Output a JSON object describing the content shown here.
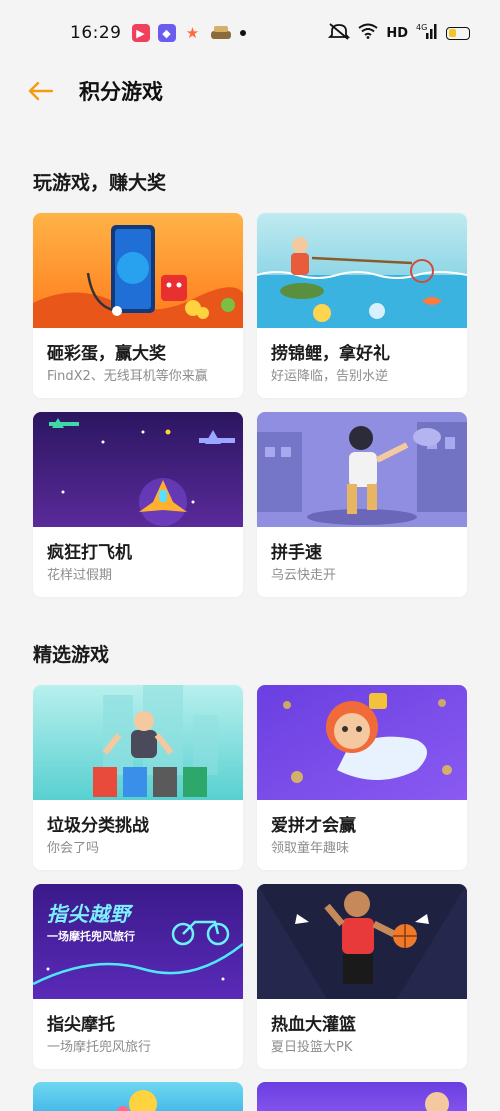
{
  "status_bar": {
    "time": "16:29",
    "network": "HD",
    "signal": "4G"
  },
  "header": {
    "title": "积分游戏",
    "back_icon": "arrow-left-icon",
    "accent": "#f39c12"
  },
  "sections": [
    {
      "title": "玩游戏，赚大奖",
      "cards": [
        {
          "name": "砸彩蛋，赢大奖",
          "desc": "FindX2、无线耳机等你来赢"
        },
        {
          "name": "捞锦鲤，拿好礼",
          "desc": "好运降临，告别水逆"
        },
        {
          "name": "疯狂打飞机",
          "desc": "花样过假期"
        },
        {
          "name": "拼手速",
          "desc": "乌云快走开"
        }
      ]
    },
    {
      "title": "精选游戏",
      "cards": [
        {
          "name": "垃圾分类挑战",
          "desc": "你会了吗"
        },
        {
          "name": "爱拼才会赢",
          "desc": "领取童年趣味"
        },
        {
          "name": "指尖摩托",
          "desc": "一场摩托兜风旅行",
          "banner_title": "指尖越野",
          "banner_subtitle": "一场摩托兜风旅行"
        },
        {
          "name": "热血大灌篮",
          "desc": "夏日投篮大PK"
        }
      ]
    }
  ]
}
